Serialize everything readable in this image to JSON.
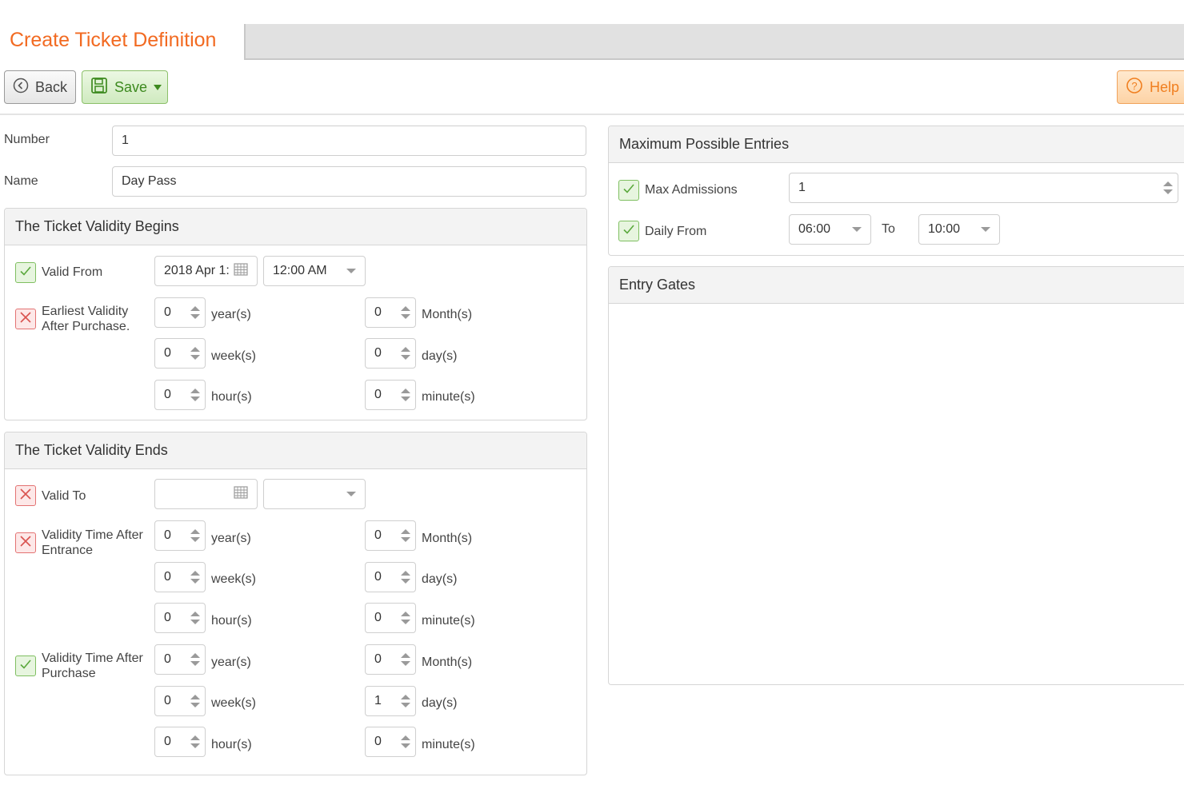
{
  "header": {
    "title": "Create Ticket Definition"
  },
  "toolbar": {
    "back_label": "Back",
    "save_label": "Save",
    "help_label": "Help"
  },
  "form": {
    "number_label": "Number",
    "number_value": "1",
    "name_label": "Name",
    "name_value": "Day Pass"
  },
  "validity_begins": {
    "title": "The Ticket Validity Begins",
    "valid_from_label": "Valid From",
    "valid_from_date": "2018 Apr 1:",
    "valid_from_time": "12:00 AM",
    "earliest_label_1": "Earliest Validity",
    "earliest_label_2": "After Purchase.",
    "earliest": {
      "years": "0",
      "months": "0",
      "weeks": "0",
      "days": "0",
      "hours": "0",
      "minutes": "0"
    }
  },
  "validity_ends": {
    "title": "The Ticket Validity Ends",
    "valid_to_label": "Valid To",
    "valid_to_date": "",
    "valid_to_time": "",
    "after_entrance_label_1": "Validity Time After",
    "after_entrance_label_2": "Entrance",
    "after_entrance": {
      "years": "0",
      "months": "0",
      "weeks": "0",
      "days": "0",
      "hours": "0",
      "minutes": "0"
    },
    "after_purchase_label_1": "Validity Time After",
    "after_purchase_label_2": "Purchase",
    "after_purchase": {
      "years": "0",
      "months": "0",
      "weeks": "0",
      "days": "1",
      "hours": "0",
      "minutes": "0"
    }
  },
  "units": {
    "year": "year(s)",
    "month": "Month(s)",
    "week": "week(s)",
    "day": "day(s)",
    "hour": "hour(s)",
    "minute": "minute(s)"
  },
  "max_entries": {
    "title": "Maximum Possible Entries",
    "max_admissions_label": "Max Admissions",
    "max_admissions_value": "1",
    "daily_from_label": "Daily From",
    "daily_from_value": "06:00",
    "to_label": "To",
    "to_value": "10:00"
  },
  "entry_gates": {
    "title": "Entry Gates"
  },
  "colors": {
    "accent": "#f26a21",
    "save_green": "#3d8a1f",
    "check_on": "#5aa83c",
    "check_off": "#d9534f"
  }
}
